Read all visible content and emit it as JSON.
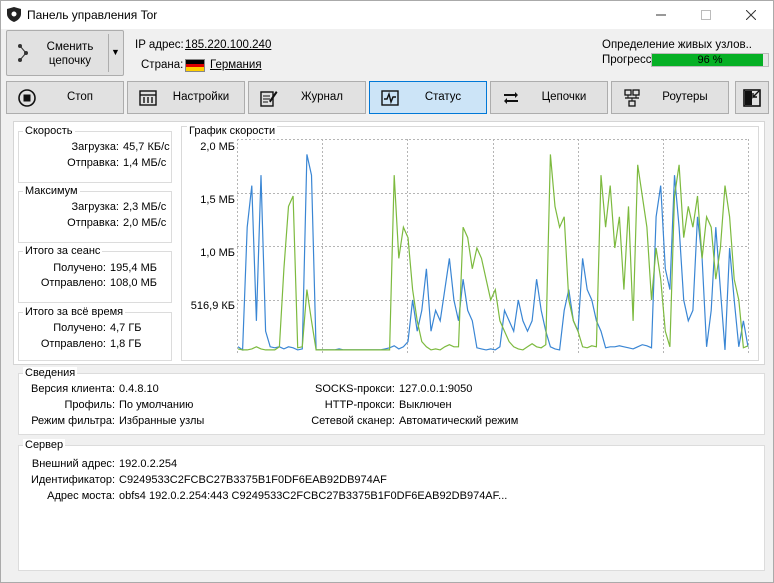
{
  "window": {
    "title": "Панель управления Tor"
  },
  "top": {
    "circuit_button": "Сменить цепочку",
    "ip_label": "IP адрес:",
    "ip_value": "185.220.100.240",
    "country_label": "Страна:",
    "country_value": "Германия",
    "status_text": "Определение живых узлов..",
    "progress_label": "Прогресс",
    "progress_percent": "96 %",
    "progress_fraction": 0.96,
    "progress_color": "#06b025"
  },
  "toolbar": {
    "stop": "Стоп",
    "settings": "Настройки",
    "log": "Журнал",
    "status": "Статус",
    "circuits": "Цепочки",
    "routers": "Роутеры"
  },
  "speed": {
    "title": "Скорость",
    "download_label": "Загрузка:",
    "download_value": "45,7 КБ/с",
    "upload_label": "Отправка:",
    "upload_value": "1,4 МБ/с"
  },
  "maximum": {
    "title": "Максимум",
    "download_label": "Загрузка:",
    "download_value": "2,3 МБ/с",
    "upload_label": "Отправка:",
    "upload_value": "2,0 МБ/с"
  },
  "session": {
    "title": "Итого за сеанс",
    "received_label": "Получено:",
    "received_value": "195,4 МБ",
    "sent_label": "Отправлено:",
    "sent_value": "108,0 МБ"
  },
  "alltime": {
    "title": "Итого за всё время",
    "received_label": "Получено:",
    "received_value": "4,7 ГБ",
    "sent_label": "Отправлено:",
    "sent_value": "1,8 ГБ"
  },
  "chart_data": {
    "type": "line",
    "title": "График скорости",
    "y_ticks": [
      "2,0 МБ",
      "1,5 МБ",
      "1,0 МБ",
      "516,9 КБ"
    ],
    "ylim": [
      0,
      2.0
    ],
    "series": [
      {
        "color": "#3a86d4",
        "values": [
          0.05,
          0.02,
          1.2,
          1.6,
          0.3,
          1.7,
          0.2,
          0.05,
          0.04,
          0.05,
          0.03,
          0.05,
          0.04,
          0.02,
          0.03,
          1.9,
          1.7,
          0.02,
          0.02,
          0.02,
          0.02,
          0.02,
          0.03,
          0.02,
          0.02,
          0.02,
          0.02,
          0.02,
          0.02,
          0.02,
          0.02,
          0.02,
          0.03,
          0.04,
          0.06,
          0.03,
          0.05,
          0.1,
          0.5,
          0.2,
          0.4,
          0.8,
          0.2,
          0.4,
          0.3,
          0.6,
          0.9,
          0.5,
          0.3,
          0.7,
          0.4,
          0.3,
          0.04,
          0.03,
          0.02,
          0.03,
          0.02,
          0.05,
          0.4,
          0.3,
          0.2,
          0.5,
          0.3,
          0.2,
          0.3,
          0.7,
          0.4,
          0.2,
          0.05,
          0.03,
          0.02,
          0.4,
          0.6,
          0.3,
          0.2,
          0.9,
          0.6,
          0.5,
          0.3,
          0.2,
          0.04,
          0.05,
          0.05,
          0.06,
          0.05,
          0.04,
          0.03,
          0.05,
          0.07,
          0.06,
          0.04,
          1.3,
          1.6,
          0.8,
          0.6,
          1.7,
          1.2,
          0.5,
          0.3,
          0.4,
          1.3,
          0.9,
          0.05,
          0.4,
          1.2,
          0.6,
          0.02,
          1.0,
          0.5,
          0.05,
          0.3,
          0.05
        ]
      },
      {
        "color": "#7dba3f",
        "values": [
          0.03,
          0.02,
          0.02,
          0.03,
          0.05,
          0.03,
          0.02,
          0.02,
          0.02,
          0.05,
          0.8,
          1.4,
          1.5,
          0.04,
          0.05,
          0.6,
          0.3,
          0.02,
          0.02,
          0.02,
          0.02,
          0.02,
          0.02,
          0.02,
          0.02,
          0.02,
          0.02,
          0.02,
          0.02,
          0.02,
          0.02,
          0.02,
          0.02,
          0.02,
          1.7,
          0.9,
          1.2,
          1.1,
          0.6,
          0.3,
          0.1,
          0.05,
          0.02,
          0.03,
          0.02,
          0.05,
          0.07,
          0.05,
          0.05,
          1.2,
          1.1,
          0.8,
          1.0,
          0.9,
          0.7,
          0.5,
          0.6,
          0.3,
          0.2,
          0.1,
          0.05,
          0.03,
          0.02,
          0.05,
          0.08,
          0.05,
          0.04,
          0.07,
          1.9,
          1.4,
          1.2,
          1.3,
          0.5,
          0.3,
          0.2,
          0.05,
          0.04,
          0.06,
          0.05,
          1.7,
          1.2,
          1.6,
          1.0,
          1.3,
          0.6,
          1.4,
          0.3,
          1.8,
          1.5,
          1.2,
          0.5,
          1.0,
          0.7,
          0.2,
          0.05,
          1.5,
          1.8,
          1.1,
          1.4,
          1.2,
          1.5,
          0.9,
          1.3,
          1.2,
          0.7,
          1.0,
          1.6,
          1.3,
          0.7,
          0.5,
          0.04,
          0.06
        ]
      }
    ]
  },
  "info": {
    "title": "Сведения",
    "client_version_label": "Версия клиента:",
    "client_version_value": "0.4.8.10",
    "profile_label": "Профиль:",
    "profile_value": "По умолчанию",
    "filter_label": "Режим фильтра:",
    "filter_value": "Избранные узлы",
    "socks_label": "SOCKS-прокси:",
    "socks_value": "127.0.0.1:9050",
    "http_label": "HTTP-прокси:",
    "http_value": "Выключен",
    "scanner_label": "Сетевой сканер:",
    "scanner_value": "Автоматический режим"
  },
  "server": {
    "title": "Сервер",
    "external_label": "Внешний адрес:",
    "external_value": "192.0.2.254",
    "id_label": "Идентификатор:",
    "id_value": "C9249533C2FCBC27B3375B1F0DF6EAB92DB974AF",
    "bridge_label": "Адрес моста:",
    "bridge_value": "obfs4 192.0.2.254:443 C9249533C2FCBC27B3375B1F0DF6EAB92DB974AF..."
  }
}
